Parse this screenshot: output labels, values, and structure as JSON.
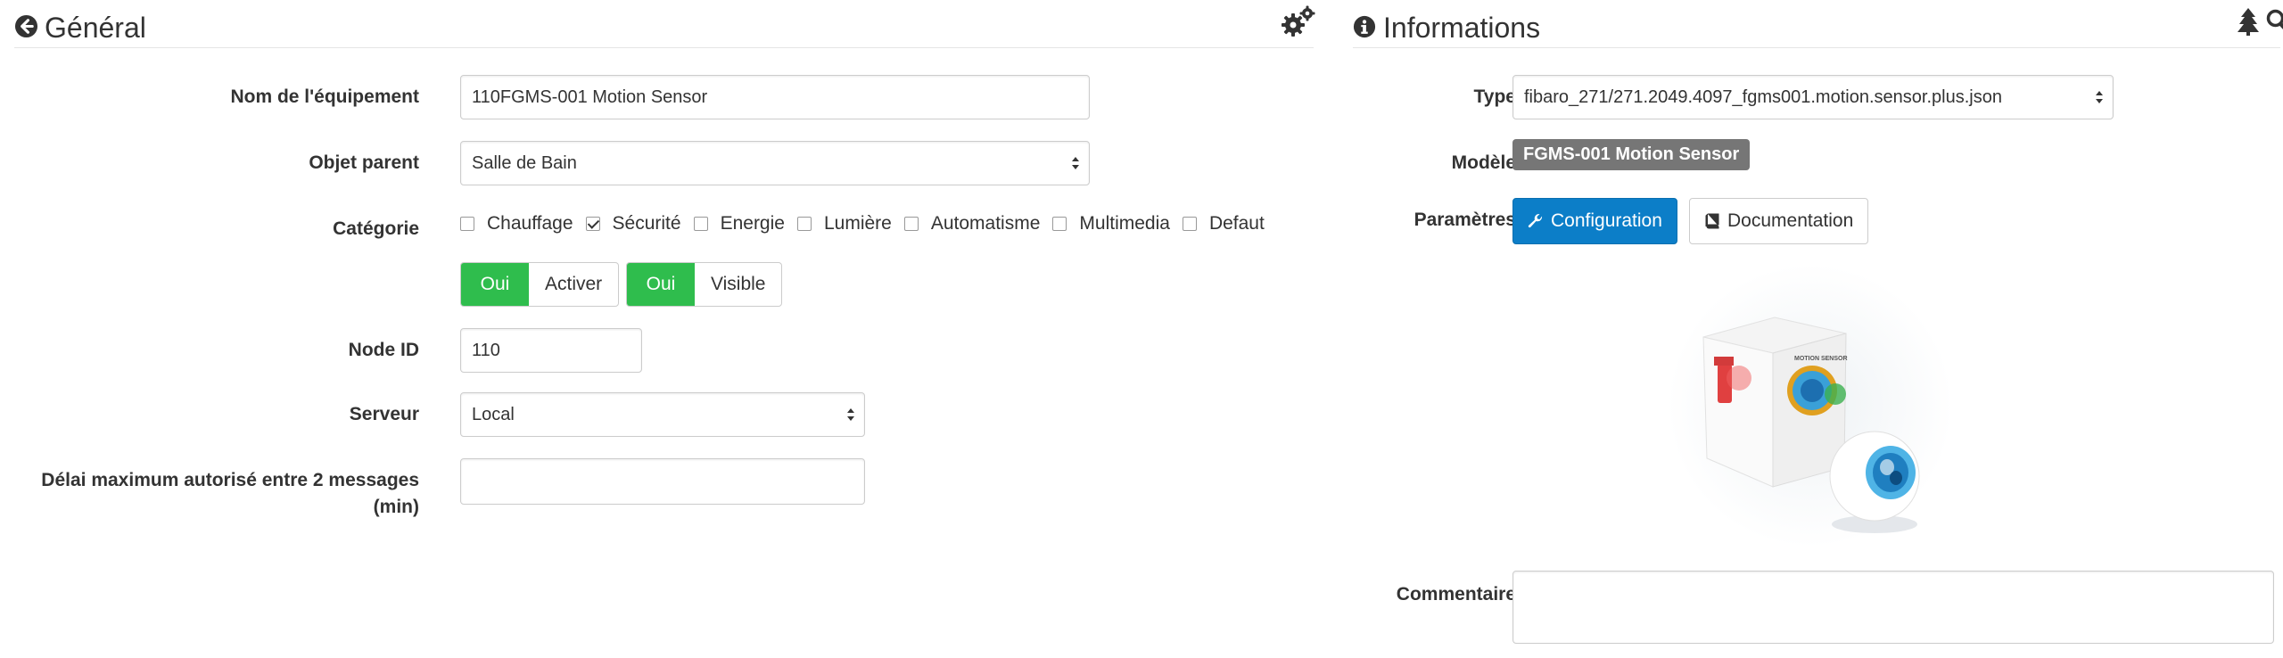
{
  "general": {
    "title": "Général",
    "labels": {
      "name": "Nom de l'équipement",
      "parent": "Objet parent",
      "category": "Catégorie",
      "node_id": "Node ID",
      "server": "Serveur",
      "max_delay_line1": "Délai maximum autorisé entre 2 messages",
      "max_delay_line2": "(min)"
    },
    "fields": {
      "name_value": "110FGMS-001 Motion Sensor",
      "parent_value": "Salle de Bain",
      "node_id_value": "110",
      "server_value": "Local",
      "max_delay_value": ""
    },
    "categories": [
      {
        "label": "Chauffage",
        "checked": false
      },
      {
        "label": "Sécurité",
        "checked": true
      },
      {
        "label": "Energie",
        "checked": false
      },
      {
        "label": "Lumière",
        "checked": false
      },
      {
        "label": "Automatisme",
        "checked": false
      },
      {
        "label": "Multimedia",
        "checked": false
      },
      {
        "label": "Defaut",
        "checked": false
      }
    ],
    "toggles": {
      "enable_state": "Oui",
      "enable_label": "Activer",
      "visible_state": "Oui",
      "visible_label": "Visible"
    }
  },
  "informations": {
    "title": "Informations",
    "labels": {
      "type": "Type",
      "model": "Modèle",
      "params": "Paramètres",
      "comment": "Commentaire"
    },
    "type_value": "fibaro_271/271.2049.4097_fgms001.motion.sensor.plus.json",
    "model_badge": "FGMS-001 Motion Sensor",
    "buttons": {
      "configuration": "Configuration",
      "documentation": "Documentation"
    },
    "image_box_text": "MOTION SENSOR",
    "comment_value": ""
  },
  "colors": {
    "accent": "#0c7ec8",
    "success": "#2fbd4d",
    "badge": "#767676"
  }
}
